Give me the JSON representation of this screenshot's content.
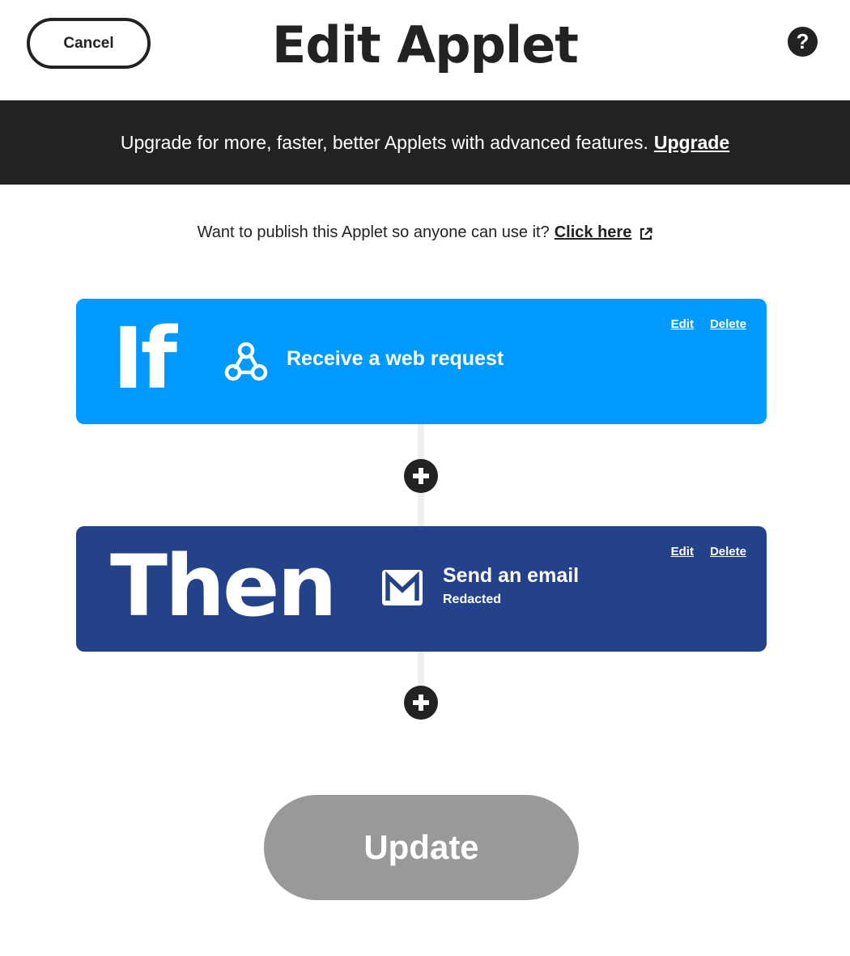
{
  "header": {
    "cancel_label": "Cancel",
    "title": "Edit Applet",
    "help_label": "?"
  },
  "banner": {
    "text": "Upgrade for more, faster, better Applets with advanced features.",
    "link_label": "Upgrade"
  },
  "publish": {
    "text": "Want to publish this Applet so anyone can use it?",
    "link_label": "Click here",
    "link_icon": "external-link-icon"
  },
  "trigger": {
    "keyword": "If",
    "title": "Receive a web request",
    "icon": "webhook-icon",
    "edit_label": "Edit",
    "delete_label": "Delete",
    "color": "#0099ff"
  },
  "action": {
    "keyword": "Then",
    "title": "Send an email",
    "subtitle": "Redacted",
    "icon": "email-icon",
    "edit_label": "Edit",
    "delete_label": "Delete",
    "color": "#234289"
  },
  "add_step_icon": "plus-icon",
  "update_label": "Update"
}
